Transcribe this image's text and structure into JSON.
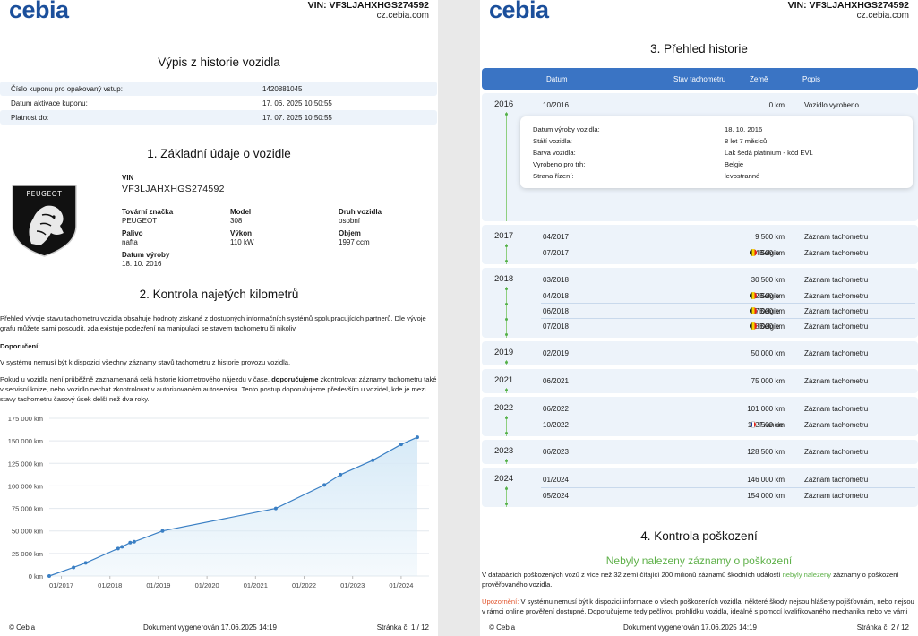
{
  "brand": "cebia",
  "header": {
    "vin": "VIN: VF3LJAHXHGS274592",
    "site": "cz.cebia.com"
  },
  "page1": {
    "title": "Výpis z historie vozidla",
    "coupon": [
      {
        "label": "Číslo kuponu pro opakovaný vstup:",
        "value": "1420881045"
      },
      {
        "label": "Datum aktivace kuponu:",
        "value": "17. 06. 2025 10:50:55"
      },
      {
        "label": "Platnost do:",
        "value": "17. 07. 2025 10:50:55"
      }
    ],
    "section1_title": "1. Základní údaje o vozidle",
    "brand_badge": "PEUGEOT",
    "vin_label": "VIN",
    "vin_value": "VF3LJAHXHGS274592",
    "vehicle": [
      {
        "label": "Tovární značka",
        "value": "PEUGEOT"
      },
      {
        "label": "Model",
        "value": "308"
      },
      {
        "label": "Druh vozidla",
        "value": "osobní"
      },
      {
        "label": "Palivo",
        "value": "nafta"
      },
      {
        "label": "Výkon",
        "value": "110 kW"
      },
      {
        "label": "Objem",
        "value": "1997 ccm"
      },
      {
        "label": "Datum výroby",
        "value": "18. 10. 2016"
      }
    ],
    "section2_title": "2. Kontrola najetých kilometrů",
    "para1": "Přehled vývoje stavu tachometru vozidla obsahuje hodnoty získané z dostupných informačních systémů spolupracujících partnerů. Dle vývoje grafu můžete sami posoudit, zda existuje podezření na manipulaci se stavem tachometru či nikoliv.",
    "rec_label": "Doporučení:",
    "para2": "V systému nemusí být k dispozici všechny záznamy stavů tachometru z historie provozu vozidla.",
    "para3_a": "Pokud u vozidla není průběžně zaznamenaná celá historie kilometrového nájezdu v čase, ",
    "para3_b": "doporučujeme",
    "para3_c": " zkontrolovat záznamy tachometru také v servisní knize, nebo vozidlo nechat zkontrolovat v autorizovaném autoservisu. Tento postup doporučujeme především u vozidel, kde je mezi stavy tachometru časový úsek delší než dva roky."
  },
  "chart_data": {
    "type": "area",
    "title": "",
    "xlabel": "",
    "ylabel": "",
    "y_ticks": [
      "0 km",
      "25 000 km",
      "50 000 km",
      "75 000 km",
      "100 000 km",
      "125 000 km",
      "150 000 km",
      "175 000 km"
    ],
    "ylim": [
      0,
      175000
    ],
    "x_ticks": [
      "01/2017",
      "01/2018",
      "01/2019",
      "01/2020",
      "01/2021",
      "01/2022",
      "01/2023",
      "01/2024"
    ],
    "xlim": [
      "2016-10",
      "2024-07"
    ],
    "series": [
      {
        "points": [
          [
            "2016-10",
            0
          ],
          [
            "2017-04",
            9500
          ],
          [
            "2017-07",
            14500
          ],
          [
            "2018-03",
            30500
          ],
          [
            "2018-04",
            32500
          ],
          [
            "2018-06",
            37000
          ],
          [
            "2018-07",
            38000
          ],
          [
            "2019-02",
            50000
          ],
          [
            "2021-06",
            75000
          ],
          [
            "2022-06",
            101000
          ],
          [
            "2022-10",
            112500
          ],
          [
            "2023-06",
            128500
          ],
          [
            "2024-01",
            146000
          ],
          [
            "2024-05",
            154000
          ]
        ]
      }
    ],
    "grid": true,
    "colors": {
      "line": "#3a7fc4",
      "fill": "#d7eaf7",
      "grid": "#e3e8ee"
    }
  },
  "page2": {
    "section3_title": "3. Přehled historie",
    "table_headers": {
      "date": "Datum",
      "odo": "Stav tachometru",
      "country": "Země",
      "desc": "Popis"
    },
    "groups": [
      {
        "year": "2016",
        "rows": [
          {
            "date": "10/2016",
            "km": "0 km",
            "country": "",
            "flag": "",
            "desc": "Vozidlo vyrobeno"
          }
        ]
      },
      {
        "year": "2017",
        "rows": [
          {
            "date": "04/2017",
            "km": "9 500 km",
            "country": "",
            "flag": "",
            "desc": "Záznam tachometru"
          },
          {
            "date": "07/2017",
            "km": "14 500 km",
            "country": "Belgie",
            "flag": "be",
            "desc": "Záznam tachometru"
          }
        ]
      },
      {
        "year": "2018",
        "rows": [
          {
            "date": "03/2018",
            "km": "30 500 km",
            "country": "",
            "flag": "",
            "desc": "Záznam tachometru"
          },
          {
            "date": "04/2018",
            "km": "32 500 km",
            "country": "Belgie",
            "flag": "be",
            "desc": "Záznam tachometru"
          },
          {
            "date": "06/2018",
            "km": "37 000 km",
            "country": "Belgie",
            "flag": "be",
            "desc": "Záznam tachometru"
          },
          {
            "date": "07/2018",
            "km": "38 000 km",
            "country": "Belgie",
            "flag": "be",
            "desc": "Záznam tachometru"
          }
        ]
      },
      {
        "year": "2019",
        "rows": [
          {
            "date": "02/2019",
            "km": "50 000 km",
            "country": "",
            "flag": "",
            "desc": "Záznam tachometru"
          }
        ]
      },
      {
        "year": "2021",
        "rows": [
          {
            "date": "06/2021",
            "km": "75 000 km",
            "country": "",
            "flag": "",
            "desc": "Záznam tachometru"
          }
        ]
      },
      {
        "year": "2022",
        "rows": [
          {
            "date": "06/2022",
            "km": "101 000 km",
            "country": "",
            "flag": "",
            "desc": "Záznam tachometru"
          },
          {
            "date": "10/2022",
            "km": "112 500 km",
            "country": "Francie",
            "flag": "fr",
            "desc": "Záznam tachometru"
          }
        ]
      },
      {
        "year": "2023",
        "rows": [
          {
            "date": "06/2023",
            "km": "128 500 km",
            "country": "",
            "flag": "",
            "desc": "Záznam tachometru"
          }
        ]
      },
      {
        "year": "2024",
        "rows": [
          {
            "date": "01/2024",
            "km": "146 000 km",
            "country": "",
            "flag": "",
            "desc": "Záznam tachometru"
          },
          {
            "date": "05/2024",
            "km": "154 000 km",
            "country": "",
            "flag": "",
            "desc": "Záznam tachometru"
          }
        ]
      }
    ],
    "detail_card": [
      {
        "label": "Datum výroby vozidla:",
        "value": "18. 10. 2016"
      },
      {
        "label": "Stáří vozidla:",
        "value": "8 let 7 měsíců"
      },
      {
        "label": "Barva vozidla:",
        "value": "Lak šedá platinium - kód EVL"
      },
      {
        "label": "Vyrobeno pro trh:",
        "value": "Belgie"
      },
      {
        "label": "Strana řízení:",
        "value": "levostranné"
      }
    ],
    "section4_title": "4. Kontrola poškození",
    "dmg_title": "Nebyly nalezeny záznamy o poškození",
    "dmg_p1_a": "V databázích poškozených vozů z více než 32 zemí čítající 200 milionů záznamů škodních událostí ",
    "dmg_p1_b": "nebyly nalezeny",
    "dmg_p1_c": " záznamy o poškození prověřovaného vozidla.",
    "dmg_p2_a": "Upozornění:",
    "dmg_p2_b": " V systému nemusí být k dispozici informace o všech poškozeních vozidla, některé škody nejsou hlášeny pojišťovnám, nebo nejsou v rámci online prověření dostupné. Doporučujeme tedy pečlivou prohlídku vozidla, ideálně s pomocí kvalifikovaného mechanika nebo ve vámi"
  },
  "footer": {
    "copyright": "© Cebia",
    "generated": "Dokument vygenerován 17.06.2025 14:19",
    "page1": "Stránka č. 1 / 12",
    "page2": "Stránka č. 2 / 12"
  }
}
